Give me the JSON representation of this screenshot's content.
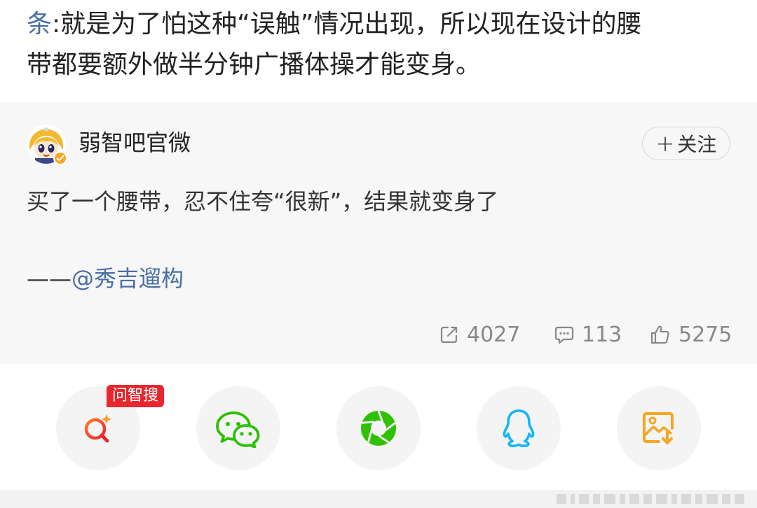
{
  "top_text": {
    "prefix": "条",
    "line1": ":就是为了怕这种“误触”情况出现，所以现在设计的腰",
    "line2": "带都要额外做半分钟广播体操才能变身。"
  },
  "quote": {
    "user_name": "弱智吧官微",
    "follow_label": "关注",
    "body": "买了一个腰带，忍不住夸“很新”，结果就变身了",
    "author_dash": "——",
    "author_mention": "@秀吉遛构",
    "stats": {
      "reposts": "4027",
      "comments": "113",
      "likes": "5275"
    }
  },
  "share": {
    "ai_tag": "问智搜",
    "buttons": [
      {
        "name": "ai-search",
        "icon": "magnifier-sparkle-icon"
      },
      {
        "name": "wechat",
        "icon": "wechat-icon"
      },
      {
        "name": "moments",
        "icon": "aperture-icon"
      },
      {
        "name": "qq",
        "icon": "qq-penguin-icon"
      },
      {
        "name": "save-image",
        "icon": "image-download-icon"
      }
    ]
  },
  "colors": {
    "link_blue": "#4a6fa5",
    "wechat_green": "#2dc100",
    "qq_blue": "#12b7f5",
    "save_orange": "#f5a623",
    "ai_red": "#e8262d"
  }
}
